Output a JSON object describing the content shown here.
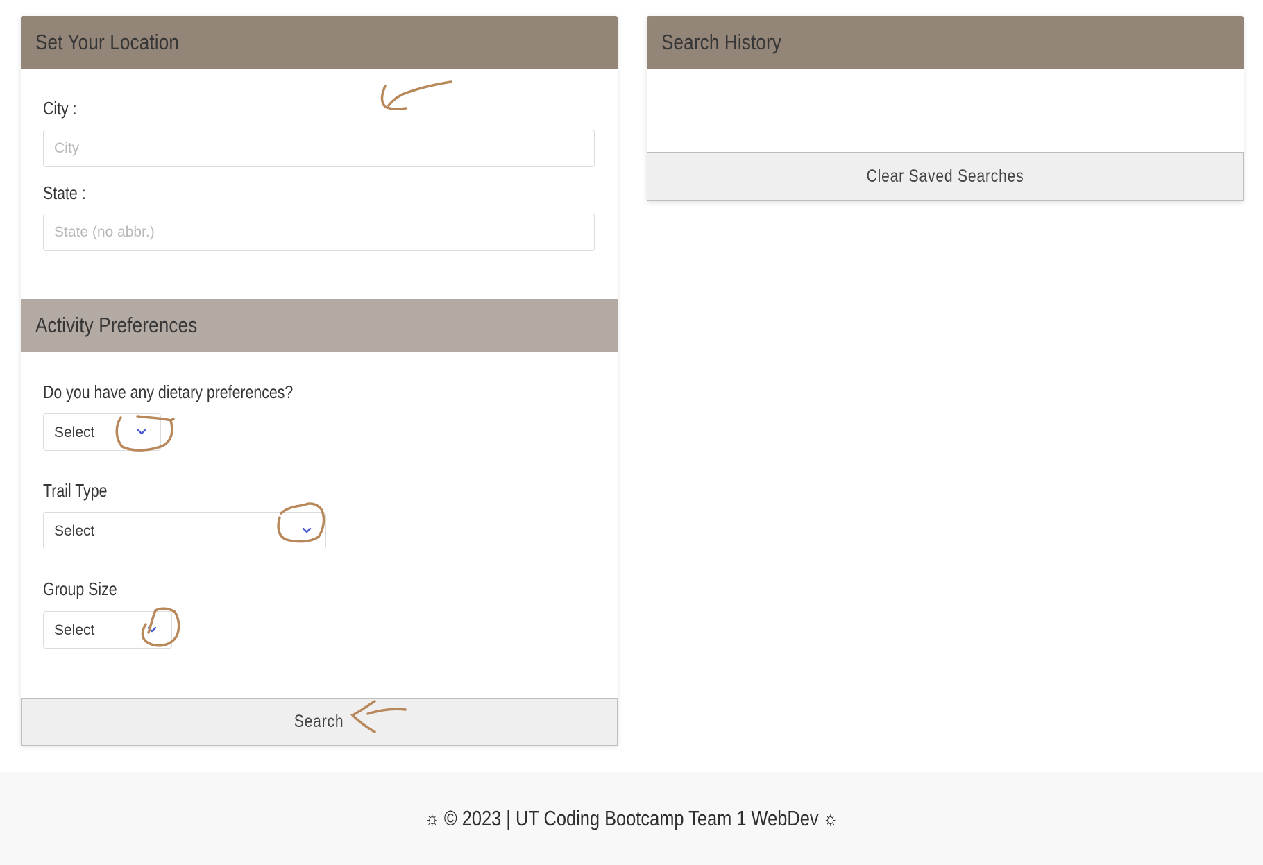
{
  "location_panel": {
    "title": "Set Your Location",
    "city_label": "City :",
    "city_placeholder": "City",
    "city_value": "",
    "state_label": "State :",
    "state_placeholder": "State (no abbr.)",
    "state_value": ""
  },
  "preferences_panel": {
    "title": "Activity Preferences",
    "dietary_label": "Do you have any dietary preferences?",
    "dietary_value": "Select",
    "trail_label": "Trail Type",
    "trail_value": "Select",
    "group_label": "Group Size",
    "group_value": "Select",
    "search_button": "Search"
  },
  "history_panel": {
    "title": "Search History",
    "clear_button": "Clear Saved Searches"
  },
  "footer": {
    "text": "© 2023 | UT Coding Bootcamp Team 1 WebDev",
    "left_icon": "☼",
    "right_icon": "☼"
  },
  "colors": {
    "header_dark": "#948579",
    "header_light": "#b3aaa4",
    "chevron": "#4a5bd0",
    "annotation": "#b8885a"
  }
}
